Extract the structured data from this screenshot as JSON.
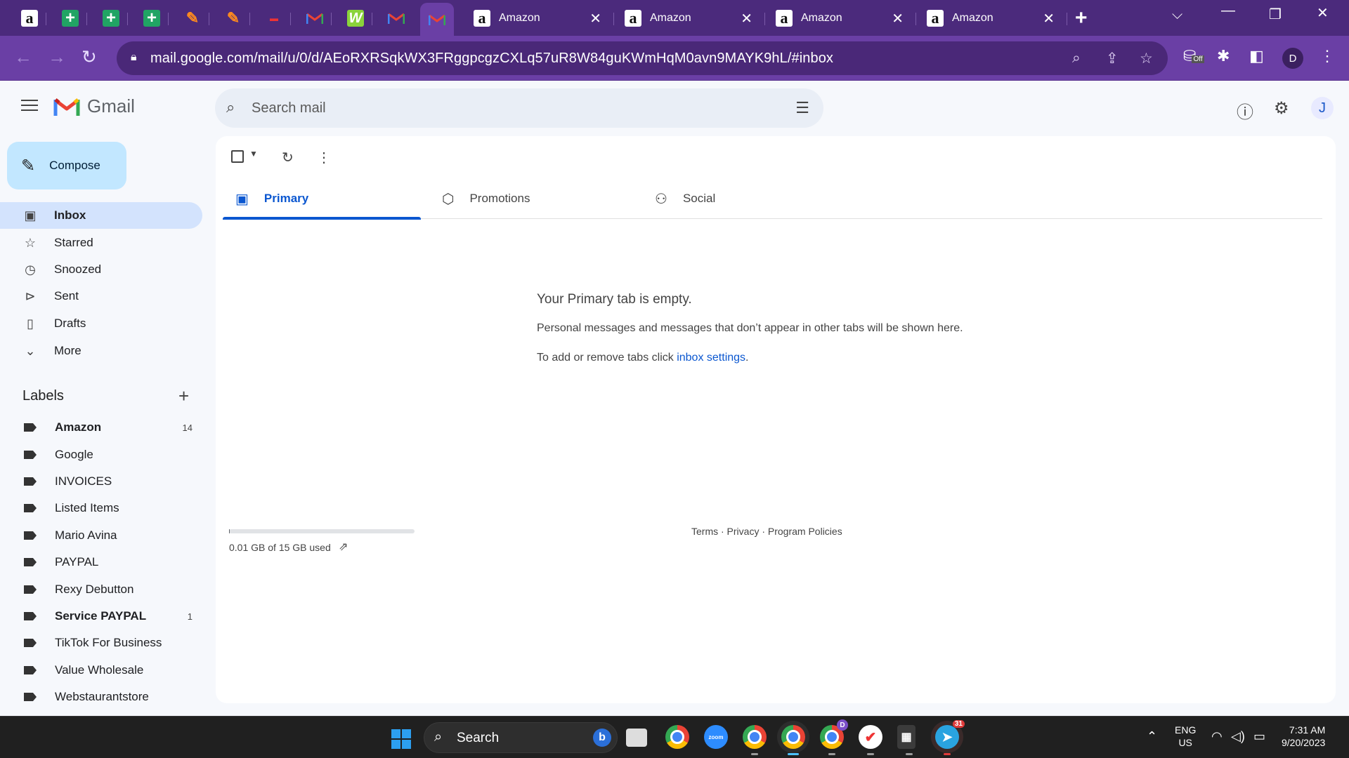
{
  "browser": {
    "tabs": [
      {
        "title": "Amazon",
        "close": "✕"
      },
      {
        "title": "Amazon",
        "close": "✕"
      },
      {
        "title": "Amazon",
        "close": "✕"
      },
      {
        "title": "Amazon",
        "close": "✕"
      }
    ],
    "url": "mail.google.com/mail/u/0/d/AEoRXRSqkWX3FRggpcgzCXLq57uR8W84guKWmHqM0avn9MAYK9hL/#inbox",
    "profile_initial": "D",
    "extension_badge": "Off"
  },
  "header": {
    "app_name": "Gmail",
    "search_placeholder": "Search mail",
    "account_initial": "J"
  },
  "nav": {
    "compose_label": "Compose",
    "items": [
      {
        "label": "Inbox",
        "icon": "inbox-icon"
      },
      {
        "label": "Starred",
        "icon": "star-icon"
      },
      {
        "label": "Snoozed",
        "icon": "clock-icon"
      },
      {
        "label": "Sent",
        "icon": "send-icon"
      },
      {
        "label": "Drafts",
        "icon": "draft-icon"
      },
      {
        "label": "More",
        "icon": "chevron-down-icon"
      }
    ],
    "labels_header": "Labels",
    "labels": [
      {
        "label": "Amazon",
        "count": "14"
      },
      {
        "label": "Google",
        "count": ""
      },
      {
        "label": "INVOICES",
        "count": ""
      },
      {
        "label": "Listed Items",
        "count": ""
      },
      {
        "label": "Mario Avina",
        "count": ""
      },
      {
        "label": "PAYPAL",
        "count": ""
      },
      {
        "label": "Rexy Debutton",
        "count": ""
      },
      {
        "label": "Service PAYPAL",
        "count": "1"
      },
      {
        "label": "TikTok For Business",
        "count": ""
      },
      {
        "label": "Value Wholesale",
        "count": ""
      },
      {
        "label": "Webstaurantstore",
        "count": ""
      }
    ]
  },
  "main": {
    "tabs": [
      {
        "label": "Primary"
      },
      {
        "label": "Promotions"
      },
      {
        "label": "Social"
      }
    ],
    "empty_title": "Your Primary tab is empty.",
    "empty_desc": "Personal messages and messages that don’t appear in other tabs will be shown here.",
    "empty_settings_prefix": "To add or remove tabs click ",
    "empty_settings_link": "inbox settings",
    "empty_settings_suffix": ".",
    "storage_text": "0.01 GB of 15 GB used",
    "storage_fraction": 0.001,
    "footer": "Terms · Privacy · Program Policies"
  },
  "taskbar": {
    "search_label": "Search",
    "lang_line1": "ENG",
    "lang_line2": "US",
    "time": "7:31 AM",
    "date": "9/20/2023",
    "telegram_badge": "31",
    "chrome_profile_badge": "D"
  }
}
